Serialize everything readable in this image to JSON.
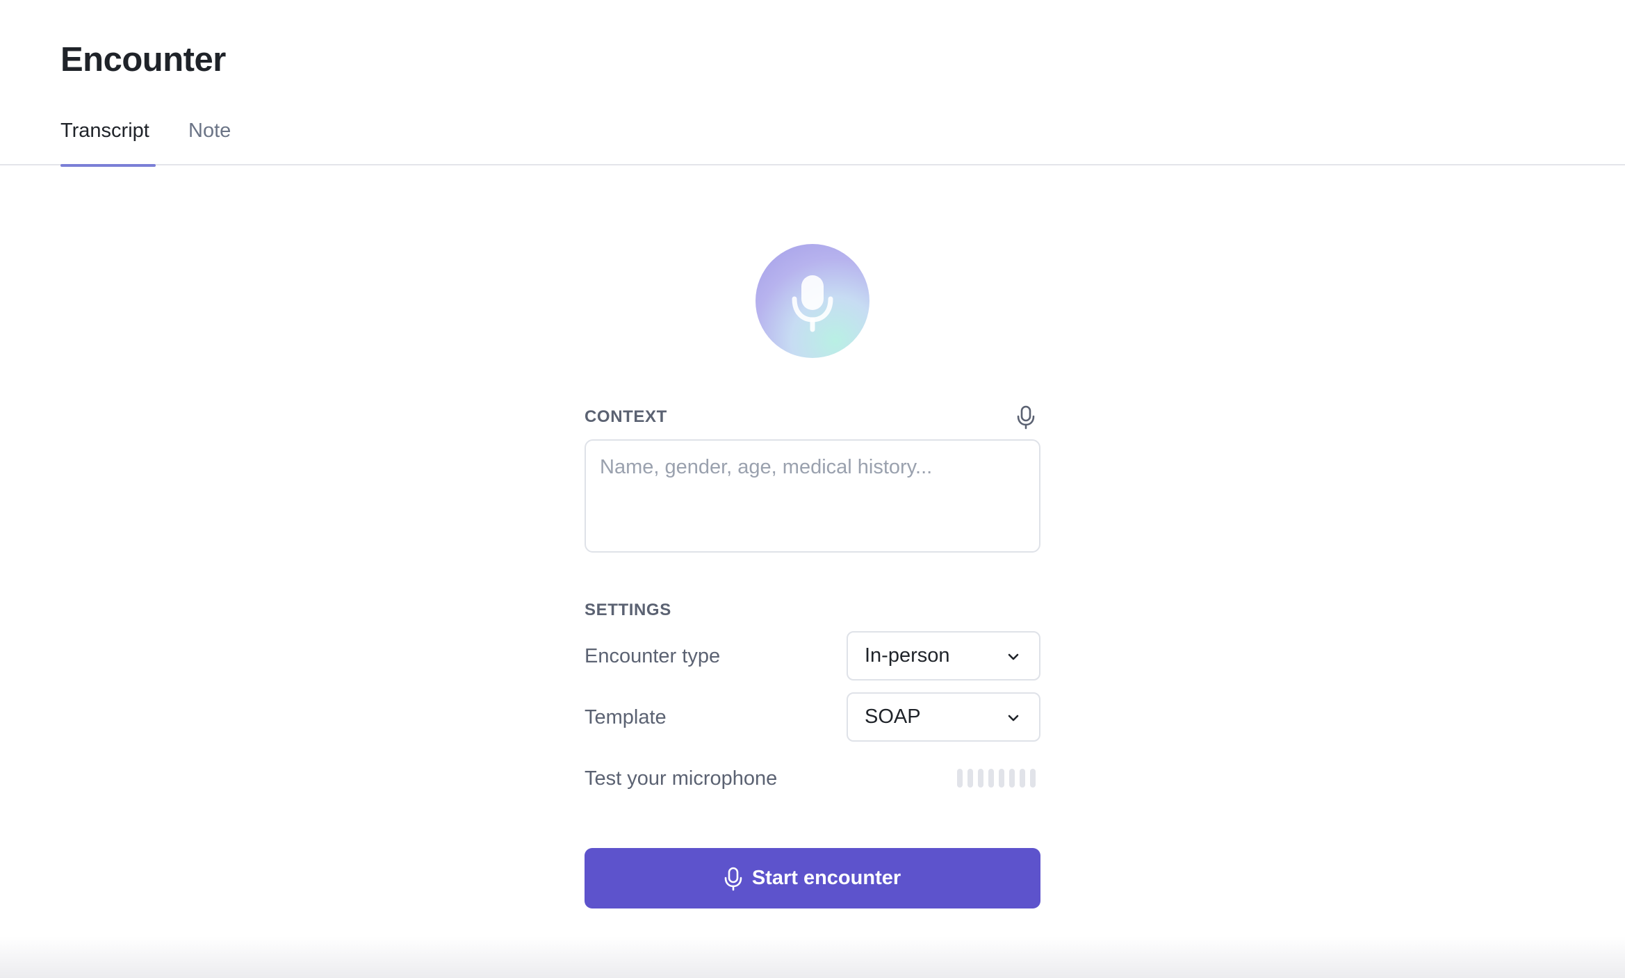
{
  "page": {
    "title": "Encounter"
  },
  "tabs": [
    {
      "label": "Transcript",
      "active": true
    },
    {
      "label": "Note",
      "active": false
    }
  ],
  "context": {
    "label": "CONTEXT",
    "placeholder": "Name, gender, age, medical history...",
    "value": "",
    "dictate_icon": "microphone-icon"
  },
  "settings": {
    "label": "SETTINGS",
    "encounter_type": {
      "label": "Encounter type",
      "selected": "In-person"
    },
    "template": {
      "label": "Template",
      "selected": "SOAP"
    },
    "mic_test": {
      "label": "Test your microphone",
      "level": 0
    }
  },
  "start_button": {
    "label": "Start encounter",
    "icon": "microphone-icon"
  },
  "colors": {
    "accent": "#5d53cc",
    "tab_indicator": "#7b7fd6",
    "hero_gradient": [
      "#a39de8",
      "#b9f0e4"
    ]
  }
}
